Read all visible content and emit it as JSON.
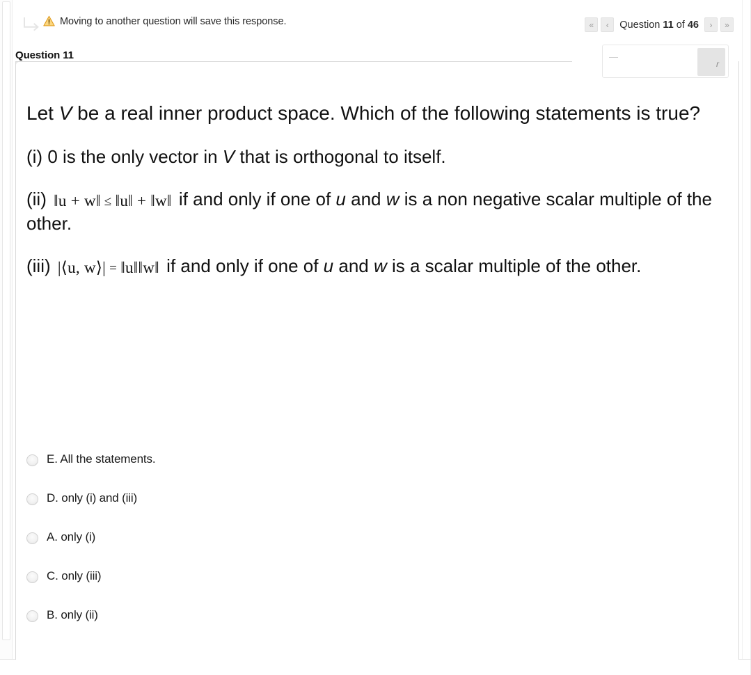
{
  "notice": {
    "icon": "warning-triangle-icon",
    "return_icon": "return-arrow-icon",
    "text": "Moving to another question will save this response."
  },
  "pager": {
    "first_label": "«",
    "prev_label": "‹",
    "next_label": "›",
    "last_label": "»",
    "prefix": "Question ",
    "current": "11",
    "middle": " of ",
    "total": "46"
  },
  "question": {
    "title": "Question 11",
    "stem_part1": "Let ",
    "stem_var": "V",
    "stem_part2": " be a real inner product space. Which of the following statements is true?",
    "statements": [
      {
        "marker": "(i)",
        "text_before": "0 is the only vector in ",
        "var1": "V",
        "text_after": " that is orthogonal to itself.",
        "formula": "",
        "tail": ""
      },
      {
        "marker": "(ii)",
        "formula_norm_left": "‖u + w‖",
        "formula_rel": "≤",
        "formula_norm_right": "‖u‖ + ‖w‖",
        "text_before": " if and only if one of ",
        "var1": "u",
        "text_mid": " and ",
        "var2": "w",
        "text_after": " is a non negative scalar multiple of the other."
      },
      {
        "marker": "(iii)",
        "formula_left": "|⟨u, w⟩|",
        "formula_rel": "=",
        "formula_right": "‖u‖‖w‖",
        "text_before": " if and only if one of ",
        "var1": "u",
        "text_mid": " and ",
        "var2": "w",
        "text_after": " is a scalar multiple of the other."
      }
    ]
  },
  "options": [
    {
      "label": "E. All the statements.",
      "selected": false
    },
    {
      "label": "D.  only (i)  and (iii)",
      "selected": false
    },
    {
      "label": "A.  only (i)",
      "selected": false
    },
    {
      "label": "C.  only (iii)",
      "selected": false
    },
    {
      "label": "B.  only (ii)",
      "selected": false
    }
  ],
  "overlay": {
    "button_label": "r"
  },
  "colors": {
    "warning": "#f0ad31",
    "panel_border": "#d9d9d9",
    "text": "#111111",
    "pager_button_bg": "#ececec"
  }
}
